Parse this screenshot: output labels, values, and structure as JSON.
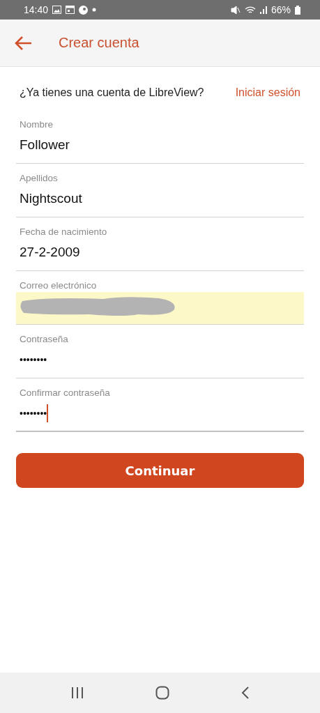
{
  "status_bar": {
    "time": "14:40",
    "battery": "66%"
  },
  "app_bar": {
    "title": "Crear cuenta"
  },
  "login_prompt": {
    "text": "¿Ya tienes una cuenta de LibreView?",
    "link": "Iniciar sesión"
  },
  "fields": [
    {
      "kind": "text",
      "label": "Nombre",
      "value": "Follower",
      "highlighted": false,
      "focused": false
    },
    {
      "kind": "text",
      "label": "Apellidos",
      "value": "Nightscout",
      "highlighted": false,
      "focused": false
    },
    {
      "kind": "text",
      "label": "Fecha de nacimiento",
      "value": "27-2-2009",
      "highlighted": false,
      "focused": false
    },
    {
      "kind": "redacted",
      "label": "Correo electrónico",
      "highlighted": true,
      "focused": false
    },
    {
      "kind": "password",
      "label": "Contraseña",
      "value": "••••••••",
      "highlighted": false,
      "focused": false
    },
    {
      "kind": "password",
      "label": "Confirmar contraseña",
      "value": "••••••••",
      "highlighted": false,
      "focused": true
    }
  ],
  "continue_button": "Continuar"
}
